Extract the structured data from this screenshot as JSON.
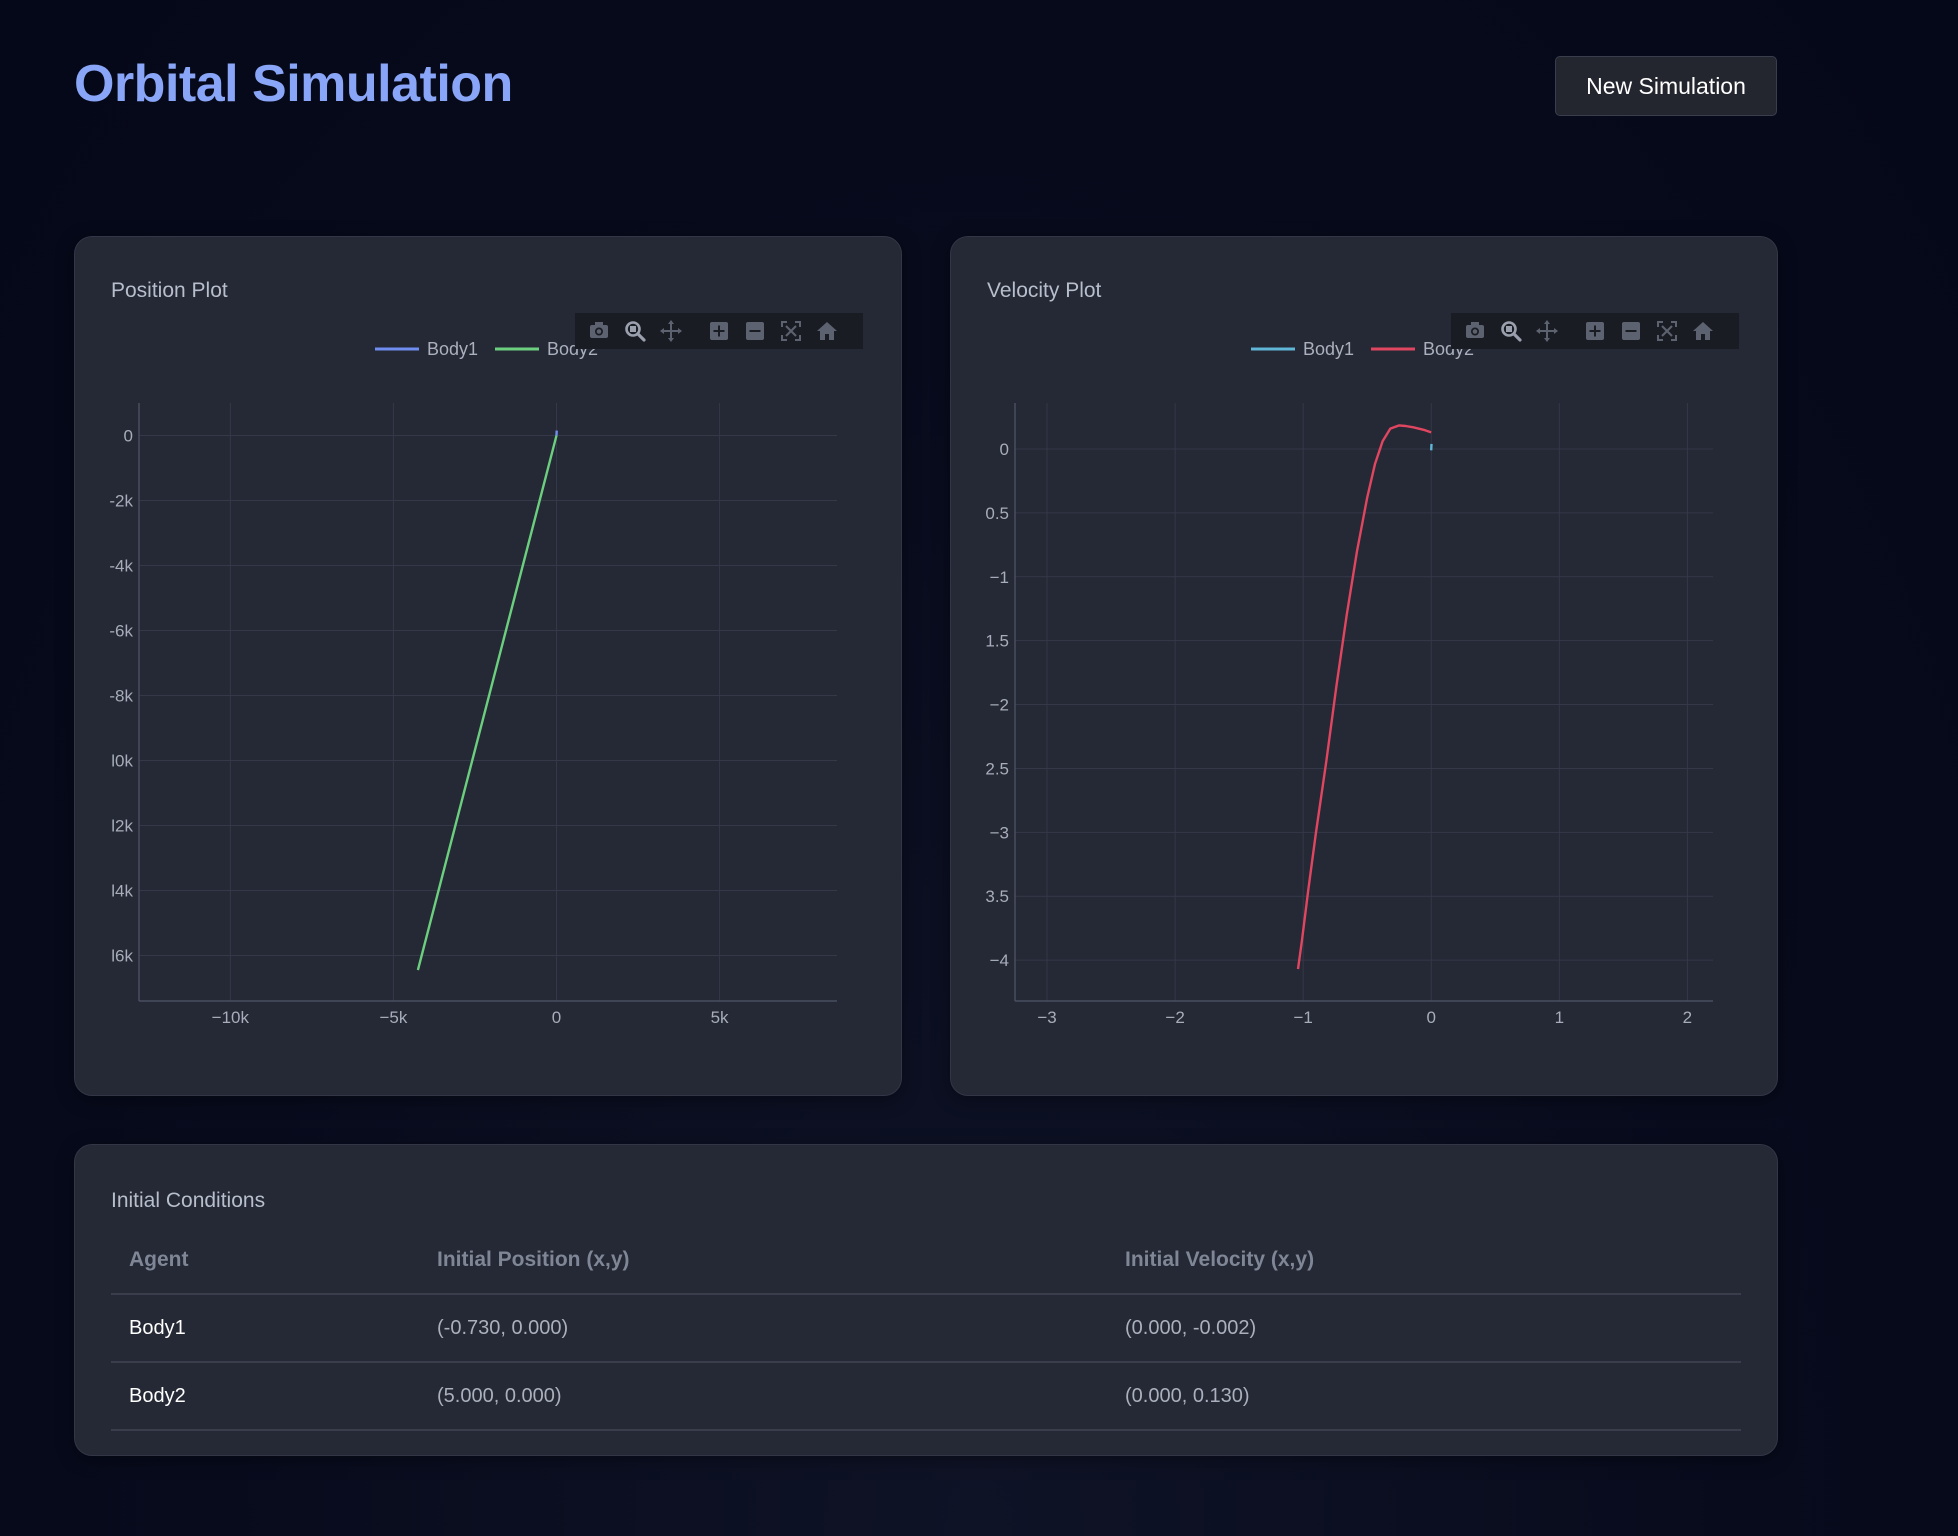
{
  "header": {
    "title": "Orbital Simulation",
    "new_button": "New Simulation"
  },
  "position_plot": {
    "title": "Position Plot",
    "legend": [
      "Body1",
      "Body2"
    ],
    "colors": [
      "#6f8cf0",
      "#6ccf7f"
    ],
    "modebar": [
      "camera-icon",
      "zoom-icon",
      "pan-icon",
      "zoom-in-icon",
      "zoom-out-icon",
      "autoscale-icon",
      "home-icon"
    ]
  },
  "velocity_plot": {
    "title": "Velocity Plot",
    "legend": [
      "Body1",
      "Body2"
    ],
    "colors": [
      "#5fb6d6",
      "#e04660"
    ],
    "modebar": [
      "camera-icon",
      "zoom-icon",
      "pan-icon",
      "zoom-in-icon",
      "zoom-out-icon",
      "autoscale-icon",
      "home-icon"
    ]
  },
  "chart_data": [
    {
      "type": "line",
      "title": "Position Plot",
      "xlim": [
        -12800,
        8600
      ],
      "ylim": [
        -17400,
        1000
      ],
      "x_ticks": [
        -10000,
        -5000,
        0,
        5000
      ],
      "x_tick_labels": [
        "−10k",
        "−5k",
        "0",
        "5k"
      ],
      "y_ticks": [
        0,
        -2000,
        -4000,
        -6000,
        -8000,
        -10000,
        -12000,
        -14000,
        -16000
      ],
      "y_tick_labels": [
        "0",
        "-2k",
        "-4k",
        "-6k",
        "-8k",
        "l0k",
        "l2k",
        "l4k",
        "l6k"
      ],
      "grid": true,
      "legend_position": "top",
      "series": [
        {
          "name": "Body1",
          "x": [
            0,
            5
          ],
          "y": [
            0,
            150
          ]
        },
        {
          "name": "Body2",
          "x": [
            0,
            -4250
          ],
          "y": [
            0,
            -16450
          ]
        }
      ]
    },
    {
      "type": "line",
      "title": "Velocity Plot",
      "xlim": [
        -3.25,
        2.2
      ],
      "ylim": [
        -4.32,
        0.36
      ],
      "x_ticks": [
        -3,
        -2,
        -1,
        0,
        1,
        2
      ],
      "x_tick_labels": [
        "−3",
        "−2",
        "−1",
        "0",
        "1",
        "2"
      ],
      "y_ticks": [
        0,
        -0.5,
        -1,
        -1.5,
        -2,
        -2.5,
        -3,
        -3.5,
        -4
      ],
      "y_tick_labels": [
        "0",
        "0.5",
        "−1",
        "1.5",
        "−2",
        "2.5",
        "−3",
        "3.5",
        "−4"
      ],
      "grid": true,
      "legend_position": "top",
      "series": [
        {
          "name": "Body1",
          "x": [
            0.0,
            0.002
          ],
          "y": [
            -0.01,
            0.04
          ]
        },
        {
          "name": "Body2",
          "x": [
            0.0,
            -0.06,
            -0.14,
            -0.2,
            -0.25,
            -0.32,
            -0.38,
            -0.44,
            -0.5,
            -0.58,
            -0.66,
            -0.74,
            -0.82,
            -0.9,
            -0.96,
            -1.01,
            -1.04
          ],
          "y": [
            0.13,
            0.15,
            0.17,
            0.18,
            0.185,
            0.16,
            0.06,
            -0.12,
            -0.38,
            -0.8,
            -1.3,
            -1.85,
            -2.45,
            -3.0,
            -3.45,
            -3.85,
            -4.07
          ]
        }
      ]
    }
  ],
  "initial_conditions": {
    "title": "Initial Conditions",
    "headers": [
      "Agent",
      "Initial Position (x,y)",
      "Initial Velocity (x,y)"
    ],
    "rows": [
      [
        "Body1",
        "(-0.730, 0.000)",
        "(0.000, -0.002)"
      ],
      [
        "Body2",
        "(5.000, 0.000)",
        "(0.000, 0.130)"
      ]
    ]
  }
}
